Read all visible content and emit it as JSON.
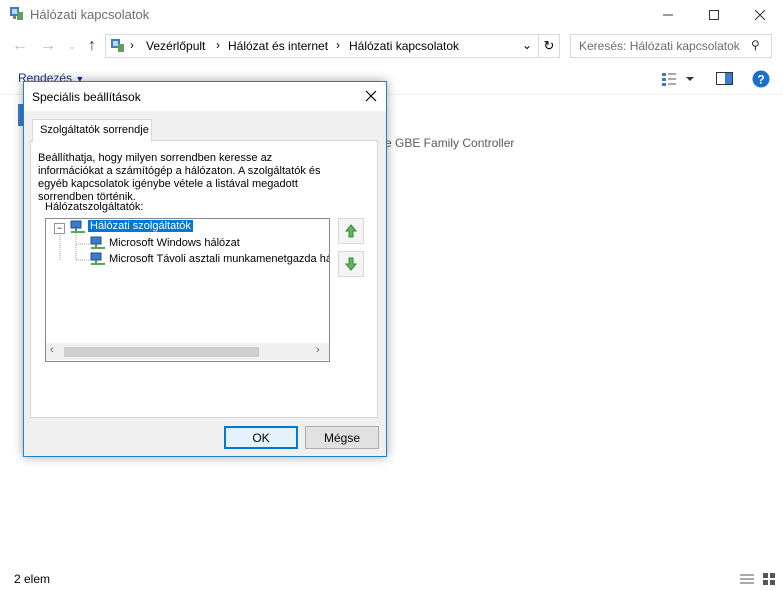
{
  "window": {
    "title": "Hálózati kapcsolatok",
    "minimize_icon": "minimize-icon",
    "maximize_icon": "maximize-icon",
    "close_icon": "close-icon"
  },
  "address_bar": {
    "crumbs": [
      "Vezérlőpult",
      "Hálózat és internet",
      "Hálózati kapcsolatok"
    ],
    "search_placeholder": "Keresés: Hálózati kapcsolatok"
  },
  "command_bar": {
    "organize_label": "Rendezés"
  },
  "background": {
    "adapter_text": "e GBE Family Controller"
  },
  "status_bar": {
    "item_count": "2 elem"
  },
  "dialog": {
    "title": "Speciális beállítások",
    "tab_label": "Szolgáltatók sorrendje",
    "description": "Beállíthatja, hogy milyen sorrendben keresse az információkat a számítógép a hálózaton. A szolgáltatók és egyéb kapcsolatok igénybe vétele a listával megadott sorrendben történik.",
    "list_label": "Hálózatszolgáltatók:",
    "tree": {
      "root": "Hálózati szolgáltatók",
      "children": [
        "Microsoft Windows hálózat",
        "Microsoft Távoli asztali munkamenetgazda hálózat"
      ]
    },
    "ok_label": "OK",
    "cancel_label": "Mégse",
    "accent": "#0078d7"
  }
}
